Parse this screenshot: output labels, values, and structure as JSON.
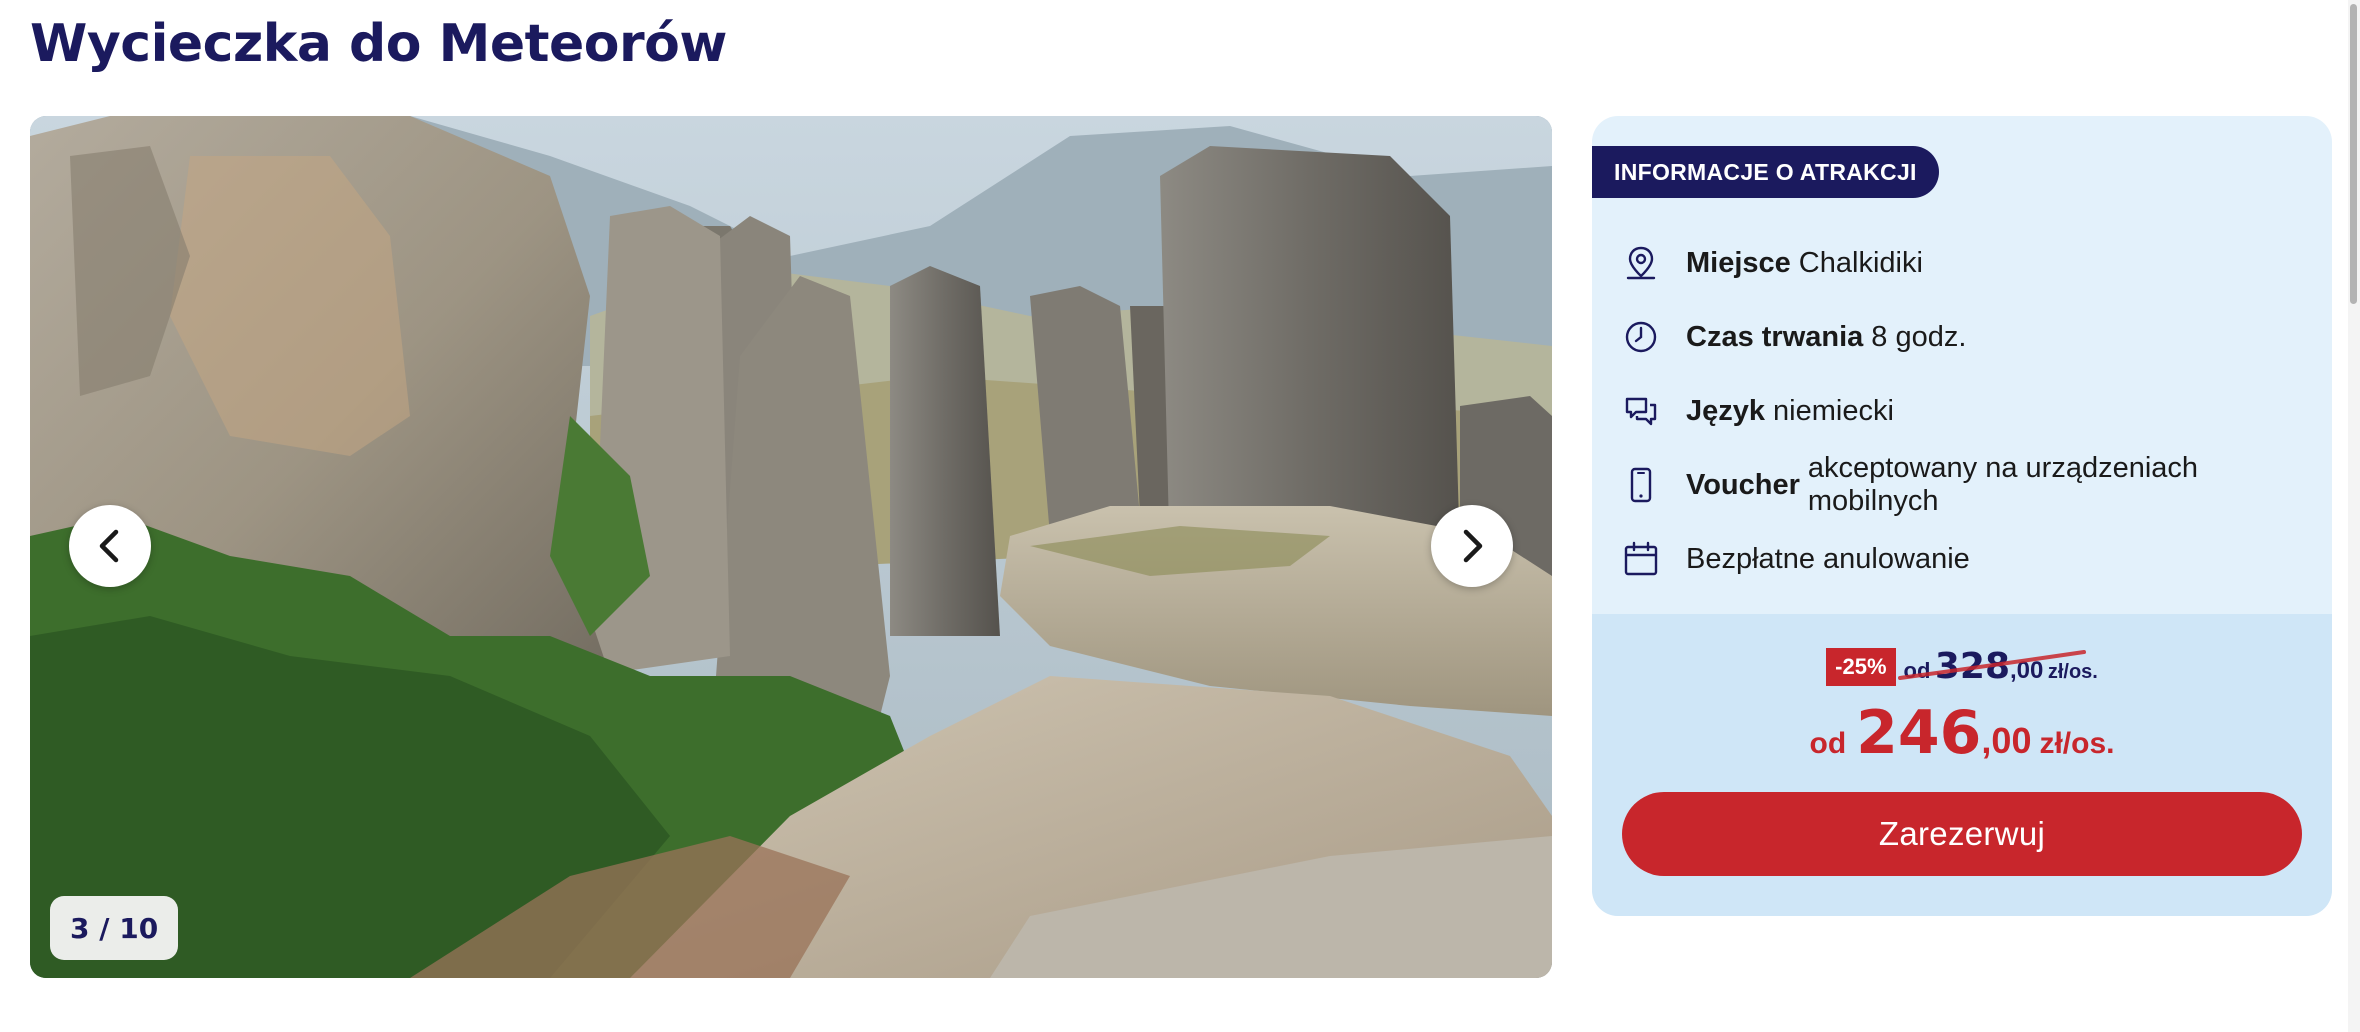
{
  "page": {
    "title": "Wycieczka do Meteorów"
  },
  "gallery": {
    "image_alt": "Meteora rock formations",
    "counter": "3 / 10",
    "prev_icon": "chevron-left-icon",
    "next_icon": "chevron-right-icon"
  },
  "info": {
    "badge": "INFORMACJE O ATRAKCJI",
    "rows": [
      {
        "icon": "location-pin-icon",
        "label": "Miejsce",
        "value": "Chalkidiki"
      },
      {
        "icon": "clock-icon",
        "label": "Czas trwania",
        "value": "8 godz."
      },
      {
        "icon": "chat-bubbles-icon",
        "label": "Język",
        "value": "niemiecki"
      },
      {
        "icon": "mobile-phone-icon",
        "label": "Voucher",
        "value": "akceptowany na urządzeniach mobilnych"
      },
      {
        "icon": "calendar-icon",
        "label": "",
        "value": "Bezpłatne anulowanie"
      }
    ]
  },
  "price": {
    "discount": "-25%",
    "old_prefix": "od",
    "old_integer": "328",
    "old_decimal": ",00",
    "old_unit": "zł/os.",
    "new_prefix": "od",
    "new_integer": "246",
    "new_decimal": ",00",
    "new_unit": "zł/os."
  },
  "booking": {
    "button_label": "Zarezerwuj"
  },
  "colors": {
    "brand_navy": "#1b1a5e",
    "accent_red": "#c8262c",
    "panel_bg": "#e3f1fb",
    "price_bg": "#cfe6f7"
  }
}
